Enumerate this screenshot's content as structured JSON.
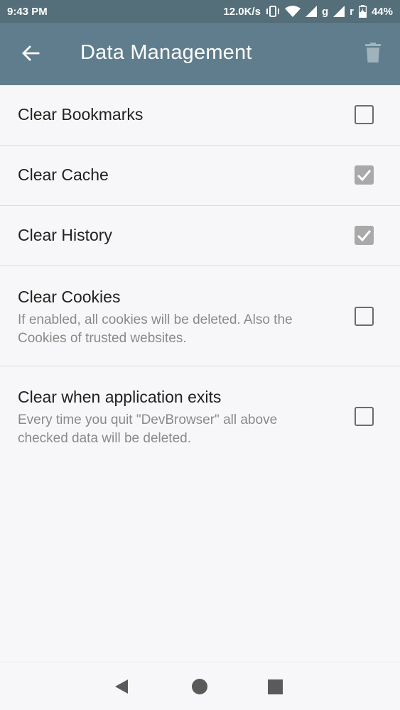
{
  "status_bar": {
    "time": "9:43 PM",
    "network_speed": "12.0K/s",
    "network_type": "g",
    "roaming": "r",
    "battery_percent": "44%",
    "icons": [
      "vibrate-icon",
      "wifi-icon",
      "signal-icon",
      "signal-icon",
      "battery-charging-icon"
    ]
  },
  "app_bar": {
    "title": "Data Management",
    "back_icon": "arrow-back-icon",
    "action_icon": "trash-icon"
  },
  "settings": [
    {
      "title": "Clear Bookmarks",
      "summary": "",
      "checked": false
    },
    {
      "title": "Clear Cache",
      "summary": "",
      "checked": true
    },
    {
      "title": "Clear History",
      "summary": "",
      "checked": true
    },
    {
      "title": "Clear Cookies",
      "summary": "If enabled, all cookies will be deleted. Also the Cookies of trusted websites.",
      "checked": false
    },
    {
      "title": "Clear when application exits",
      "summary": "Every time you quit \"DevBrowser\" all above checked data will be deleted.",
      "checked": false
    }
  ],
  "nav_bar": {
    "icons": [
      "nav-back-icon",
      "nav-home-icon",
      "nav-recents-icon"
    ]
  },
  "colors": {
    "status_bar": "#546e7a",
    "app_bar": "#5f7d8c",
    "background": "#f7f7f9",
    "checkbox_checked": "#a9a9a9"
  }
}
